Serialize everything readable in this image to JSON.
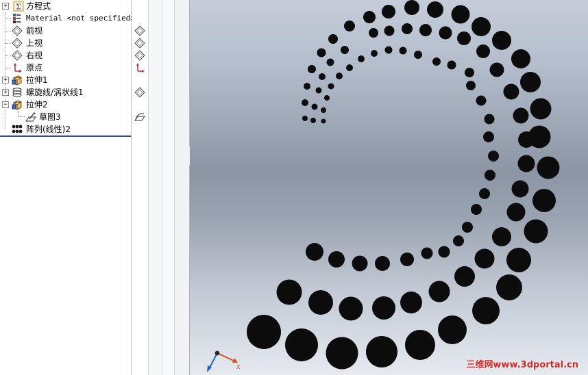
{
  "feature_tree": {
    "items": [
      {
        "id": "equations",
        "label": "方程式",
        "expander": "+",
        "icon": "sigma-icon"
      },
      {
        "id": "material",
        "label": "Material <not specified>",
        "expander": "",
        "icon": "material-icon"
      },
      {
        "id": "front-plane",
        "label": "前视",
        "expander": "",
        "icon": "plane-icon"
      },
      {
        "id": "top-plane",
        "label": "上视",
        "expander": "",
        "icon": "plane-icon"
      },
      {
        "id": "right-plane",
        "label": "右视",
        "expander": "",
        "icon": "plane-icon"
      },
      {
        "id": "origin",
        "label": "原点",
        "expander": "",
        "icon": "origin-icon"
      },
      {
        "id": "extrude1",
        "label": "拉伸1",
        "expander": "+",
        "icon": "extrude-icon"
      },
      {
        "id": "helix1",
        "label": "螺旋线/涡状线1",
        "expander": "+",
        "icon": "helix-icon"
      },
      {
        "id": "extrude2",
        "label": "拉伸2",
        "expander": "−",
        "icon": "extrude-icon"
      },
      {
        "id": "sketch3",
        "label": "草图3",
        "expander": "",
        "icon": "sketch-icon"
      },
      {
        "id": "pattern2",
        "label": "阵列(线性)2",
        "expander": "",
        "icon": "linear-pattern-icon"
      }
    ]
  },
  "watermark": "三维网www.3dportal.cn",
  "colors": {
    "rollback_bar": "#2f4f8f",
    "dot_fill": "#0c0c0c",
    "triad_x": "#d8501c",
    "triad_y": "#2a62c8"
  },
  "triad": {
    "x_label": "X"
  },
  "pattern": {
    "type": "spiral-of-holes",
    "arms": 5,
    "first_row": [
      {
        "d": 7
      },
      {
        "d": 8
      },
      {
        "d": 9
      },
      {
        "d": 10
      },
      {
        "d": 12
      }
    ]
  }
}
